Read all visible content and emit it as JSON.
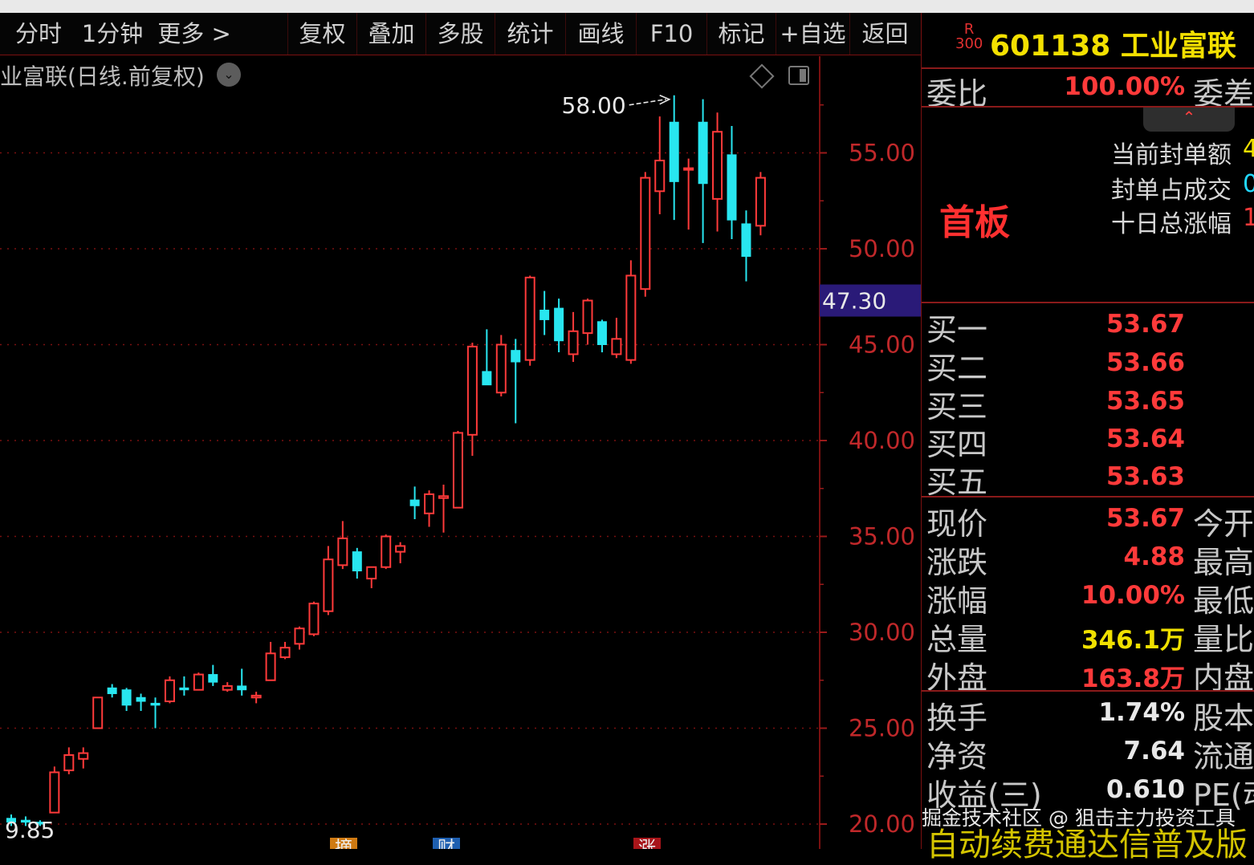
{
  "toolbar": {
    "items": [
      "分时",
      "1分钟",
      "更多 >",
      "复权",
      "叠加",
      "多股",
      "统计",
      "画线",
      "F10",
      "标记",
      "+自选",
      "返回"
    ]
  },
  "chart": {
    "title": "业富联(日线.前复权)",
    "title_dropdown": "⌄",
    "current_price_label": "47.30"
  },
  "chart_data": {
    "type": "candlestick",
    "ylim": [
      19.5,
      60
    ],
    "yticks": [
      "55.00",
      "50.00",
      "45.00",
      "40.00",
      "35.00",
      "30.00",
      "25.00",
      "20.00"
    ],
    "ytick_values": [
      55,
      50,
      45,
      40,
      35,
      30,
      25,
      20
    ],
    "high_annotation": "58.00",
    "low_annotation": "9.85",
    "candles": [
      {
        "o": 20.3,
        "h": 20.5,
        "l": 19.9,
        "c": 20.1
      },
      {
        "o": 20.2,
        "h": 20.4,
        "l": 19.9,
        "c": 20.1
      },
      {
        "o": 20.1,
        "h": 20.2,
        "l": 19.9,
        "c": 20.0
      },
      {
        "o": 20.6,
        "h": 23.0,
        "l": 20.6,
        "c": 22.7
      },
      {
        "o": 22.8,
        "h": 24.0,
        "l": 22.6,
        "c": 23.6
      },
      {
        "o": 23.4,
        "h": 24.0,
        "l": 22.9,
        "c": 23.7
      },
      {
        "o": 25.0,
        "h": 26.6,
        "l": 25.0,
        "c": 26.6
      },
      {
        "o": 27.1,
        "h": 27.3,
        "l": 26.6,
        "c": 26.8
      },
      {
        "o": 27.0,
        "h": 27.1,
        "l": 25.9,
        "c": 26.2
      },
      {
        "o": 26.6,
        "h": 26.8,
        "l": 25.9,
        "c": 26.4
      },
      {
        "o": 26.3,
        "h": 26.6,
        "l": 25.0,
        "c": 26.2
      },
      {
        "o": 26.4,
        "h": 27.7,
        "l": 26.3,
        "c": 27.5
      },
      {
        "o": 27.1,
        "h": 27.7,
        "l": 26.7,
        "c": 27.0
      },
      {
        "o": 27.0,
        "h": 27.9,
        "l": 27.0,
        "c": 27.8
      },
      {
        "o": 27.8,
        "h": 28.3,
        "l": 27.2,
        "c": 27.4
      },
      {
        "o": 27.0,
        "h": 27.4,
        "l": 26.9,
        "c": 27.2
      },
      {
        "o": 27.2,
        "h": 28.1,
        "l": 26.7,
        "c": 27.0
      },
      {
        "o": 26.6,
        "h": 26.9,
        "l": 26.3,
        "c": 26.7
      },
      {
        "o": 27.5,
        "h": 29.5,
        "l": 27.5,
        "c": 28.9
      },
      {
        "o": 28.7,
        "h": 29.5,
        "l": 28.6,
        "c": 29.2
      },
      {
        "o": 29.4,
        "h": 30.3,
        "l": 29.1,
        "c": 30.2
      },
      {
        "o": 29.9,
        "h": 31.6,
        "l": 29.8,
        "c": 31.5
      },
      {
        "o": 31.1,
        "h": 34.5,
        "l": 30.9,
        "c": 33.8
      },
      {
        "o": 33.5,
        "h": 35.8,
        "l": 33.3,
        "c": 34.9
      },
      {
        "o": 34.2,
        "h": 34.4,
        "l": 32.8,
        "c": 33.2
      },
      {
        "o": 32.8,
        "h": 33.4,
        "l": 32.3,
        "c": 33.4
      },
      {
        "o": 33.4,
        "h": 35.1,
        "l": 33.3,
        "c": 35.0
      },
      {
        "o": 34.2,
        "h": 34.7,
        "l": 33.6,
        "c": 34.5
      },
      {
        "o": 36.9,
        "h": 37.6,
        "l": 35.9,
        "c": 36.6
      },
      {
        "o": 36.2,
        "h": 37.4,
        "l": 35.5,
        "c": 37.2
      },
      {
        "o": 37.0,
        "h": 37.7,
        "l": 35.2,
        "c": 37.1
      },
      {
        "o": 36.5,
        "h": 40.5,
        "l": 36.5,
        "c": 40.4
      },
      {
        "o": 40.3,
        "h": 45.1,
        "l": 39.2,
        "c": 44.9
      },
      {
        "o": 43.6,
        "h": 45.8,
        "l": 43.0,
        "c": 42.9
      },
      {
        "o": 42.5,
        "h": 45.5,
        "l": 42.3,
        "c": 45.0
      },
      {
        "o": 44.7,
        "h": 45.3,
        "l": 40.9,
        "c": 44.1
      },
      {
        "o": 44.2,
        "h": 48.6,
        "l": 43.9,
        "c": 48.5
      },
      {
        "o": 46.8,
        "h": 47.8,
        "l": 45.5,
        "c": 46.3
      },
      {
        "o": 46.9,
        "h": 47.4,
        "l": 44.6,
        "c": 45.2
      },
      {
        "o": 44.5,
        "h": 46.7,
        "l": 44.1,
        "c": 45.7
      },
      {
        "o": 45.6,
        "h": 47.4,
        "l": 45.0,
        "c": 47.3
      },
      {
        "o": 46.2,
        "h": 46.3,
        "l": 44.6,
        "c": 45.0
      },
      {
        "o": 44.5,
        "h": 46.4,
        "l": 44.3,
        "c": 45.3
      },
      {
        "o": 44.2,
        "h": 49.4,
        "l": 44.0,
        "c": 48.6
      },
      {
        "o": 47.9,
        "h": 54.0,
        "l": 47.5,
        "c": 53.7
      },
      {
        "o": 53.0,
        "h": 56.9,
        "l": 51.8,
        "c": 54.6
      },
      {
        "o": 56.6,
        "h": 58.0,
        "l": 51.5,
        "c": 53.5
      },
      {
        "o": 54.2,
        "h": 54.7,
        "l": 51.0,
        "c": 54.2
      },
      {
        "o": 56.6,
        "h": 57.8,
        "l": 50.3,
        "c": 53.4
      },
      {
        "o": 52.6,
        "h": 57.1,
        "l": 50.9,
        "c": 56.1
      },
      {
        "o": 54.9,
        "h": 56.4,
        "l": 50.5,
        "c": 51.5
      },
      {
        "o": 51.3,
        "h": 52.0,
        "l": 48.3,
        "c": 49.6
      },
      {
        "o": 51.2,
        "h": 54.0,
        "l": 50.7,
        "c": 53.7
      }
    ]
  },
  "quote": {
    "badge_top": "R",
    "badge_bottom": "300",
    "code_name": "601138 工业富联",
    "weibi_label": "委比",
    "weibi_value": "100.00%",
    "weicha_label": "委差",
    "collapse_icon": "⌃",
    "board_tag": "首板",
    "info": [
      {
        "label": "当前封单额",
        "value": "4"
      },
      {
        "label": "封单占成交",
        "value": "0"
      },
      {
        "label": "十日总涨幅",
        "value": "1"
      }
    ],
    "bids": [
      {
        "label": "买一",
        "value": "53.67"
      },
      {
        "label": "买二",
        "value": "53.66"
      },
      {
        "label": "买三",
        "value": "53.65"
      },
      {
        "label": "买四",
        "value": "53.64"
      },
      {
        "label": "买五",
        "value": "53.63"
      }
    ],
    "stats": [
      {
        "label": "现价",
        "value": "53.67",
        "label2": "今开",
        "color": "red"
      },
      {
        "label": "涨跌",
        "value": "4.88",
        "label2": "最高",
        "color": "red"
      },
      {
        "label": "涨幅",
        "value": "10.00%",
        "label2": "最低",
        "color": "red"
      },
      {
        "label": "总量",
        "value": "346.1万",
        "label2": "量比",
        "color": "yellow"
      },
      {
        "label": "外盘",
        "value": "163.8万",
        "label2": "内盘",
        "color": "red"
      }
    ],
    "fundamentals": [
      {
        "label": "换手",
        "value": "1.74%",
        "label2": "股本"
      },
      {
        "label": "净资",
        "value": "7.64",
        "label2": "流通"
      },
      {
        "label": "收益(三)",
        "value": "0.610",
        "label2": "PE(动"
      }
    ]
  },
  "watermark": "掘金技术社区 @ 狙击主力投资工具",
  "bottom_banner": "自动续费通达信普及版",
  "bottom_markers": [
    "摘",
    "财",
    "涨"
  ]
}
